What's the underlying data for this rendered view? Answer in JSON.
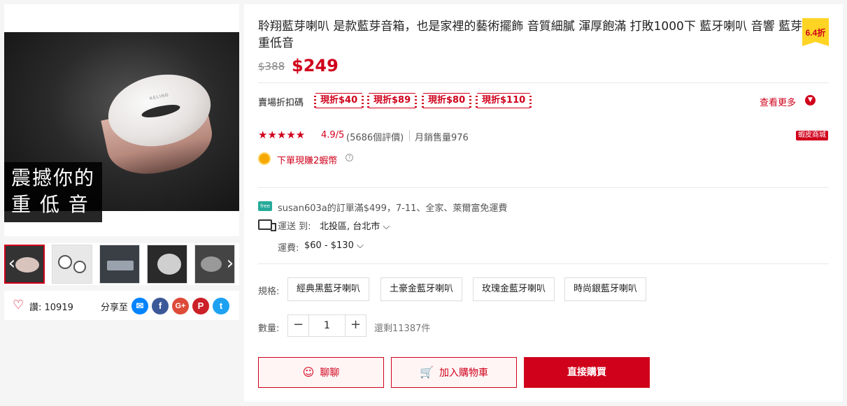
{
  "gallery": {
    "overlay_line1": "震撼你的",
    "overlay_line2": "重 低 音",
    "product_logo": "KELING",
    "prev_arrow": "‹",
    "next_arrow": "›"
  },
  "social": {
    "likes": "讚: 10919",
    "share_label": "分享至",
    "icons": [
      "messenger-icon",
      "facebook-icon",
      "google-plus-icon",
      "pinterest-icon",
      "twitter-icon"
    ],
    "icon_glyphs": {
      "facebook": "f",
      "google": "G+",
      "pinterest": "P",
      "messenger": "✉",
      "twitter": "t"
    },
    "colors": {
      "messenger": "#0084ff",
      "facebook": "#3b5998",
      "google": "#dd4b39",
      "pinterest": "#cb2027",
      "twitter": "#1da1f2"
    }
  },
  "product": {
    "title": "聆翔藍芽喇叭 是款藍芽音箱，也是家裡的藝術擺飾 音質細膩 渾厚飽滿 打敗1000下 藍牙喇叭 音響 藍芽 重低音",
    "discount_badge": "6.4折",
    "original_price": "$388",
    "price": "$249",
    "accent_color": "#d0011b"
  },
  "coupons": {
    "label": "賣場折扣碼",
    "items": [
      "現折$40",
      "現折$89",
      "現折$80",
      "現折$110"
    ],
    "more": "查看更多"
  },
  "rating": {
    "stars": "★★★★★",
    "score": "4.9/5",
    "reviews": "(5686個評價)",
    "monthly_sales": "月銷售量976",
    "badge": "蝦皮商城"
  },
  "coins": {
    "text": "下單現賺2蝦幣",
    "help": "?"
  },
  "shipping": {
    "free_icon_text": "free",
    "free_text": "susan603a的訂單滿$499，7-11、全家、萊爾富免運費",
    "ship_label": "運送  到:",
    "ship_location": "北投區, 台北市 ⌵",
    "fee_label": "運費:",
    "fee_value": "$60 - $130 ⌵"
  },
  "variants": {
    "label": "規格:",
    "options": [
      "經典黑藍牙喇叭",
      "土豪金藍牙喇叭",
      "玫瑰金藍牙喇叭",
      "時尚銀藍牙喇叭"
    ]
  },
  "quantity": {
    "label": "數量:",
    "minus": "−",
    "value": "1",
    "plus": "+",
    "stock": "還剩11387件"
  },
  "actions": {
    "chat": "聊聊",
    "chat_icon": "☺",
    "add_to_cart": "加入購物車",
    "cart_icon": "🛒",
    "buy_now": "直接購買"
  }
}
